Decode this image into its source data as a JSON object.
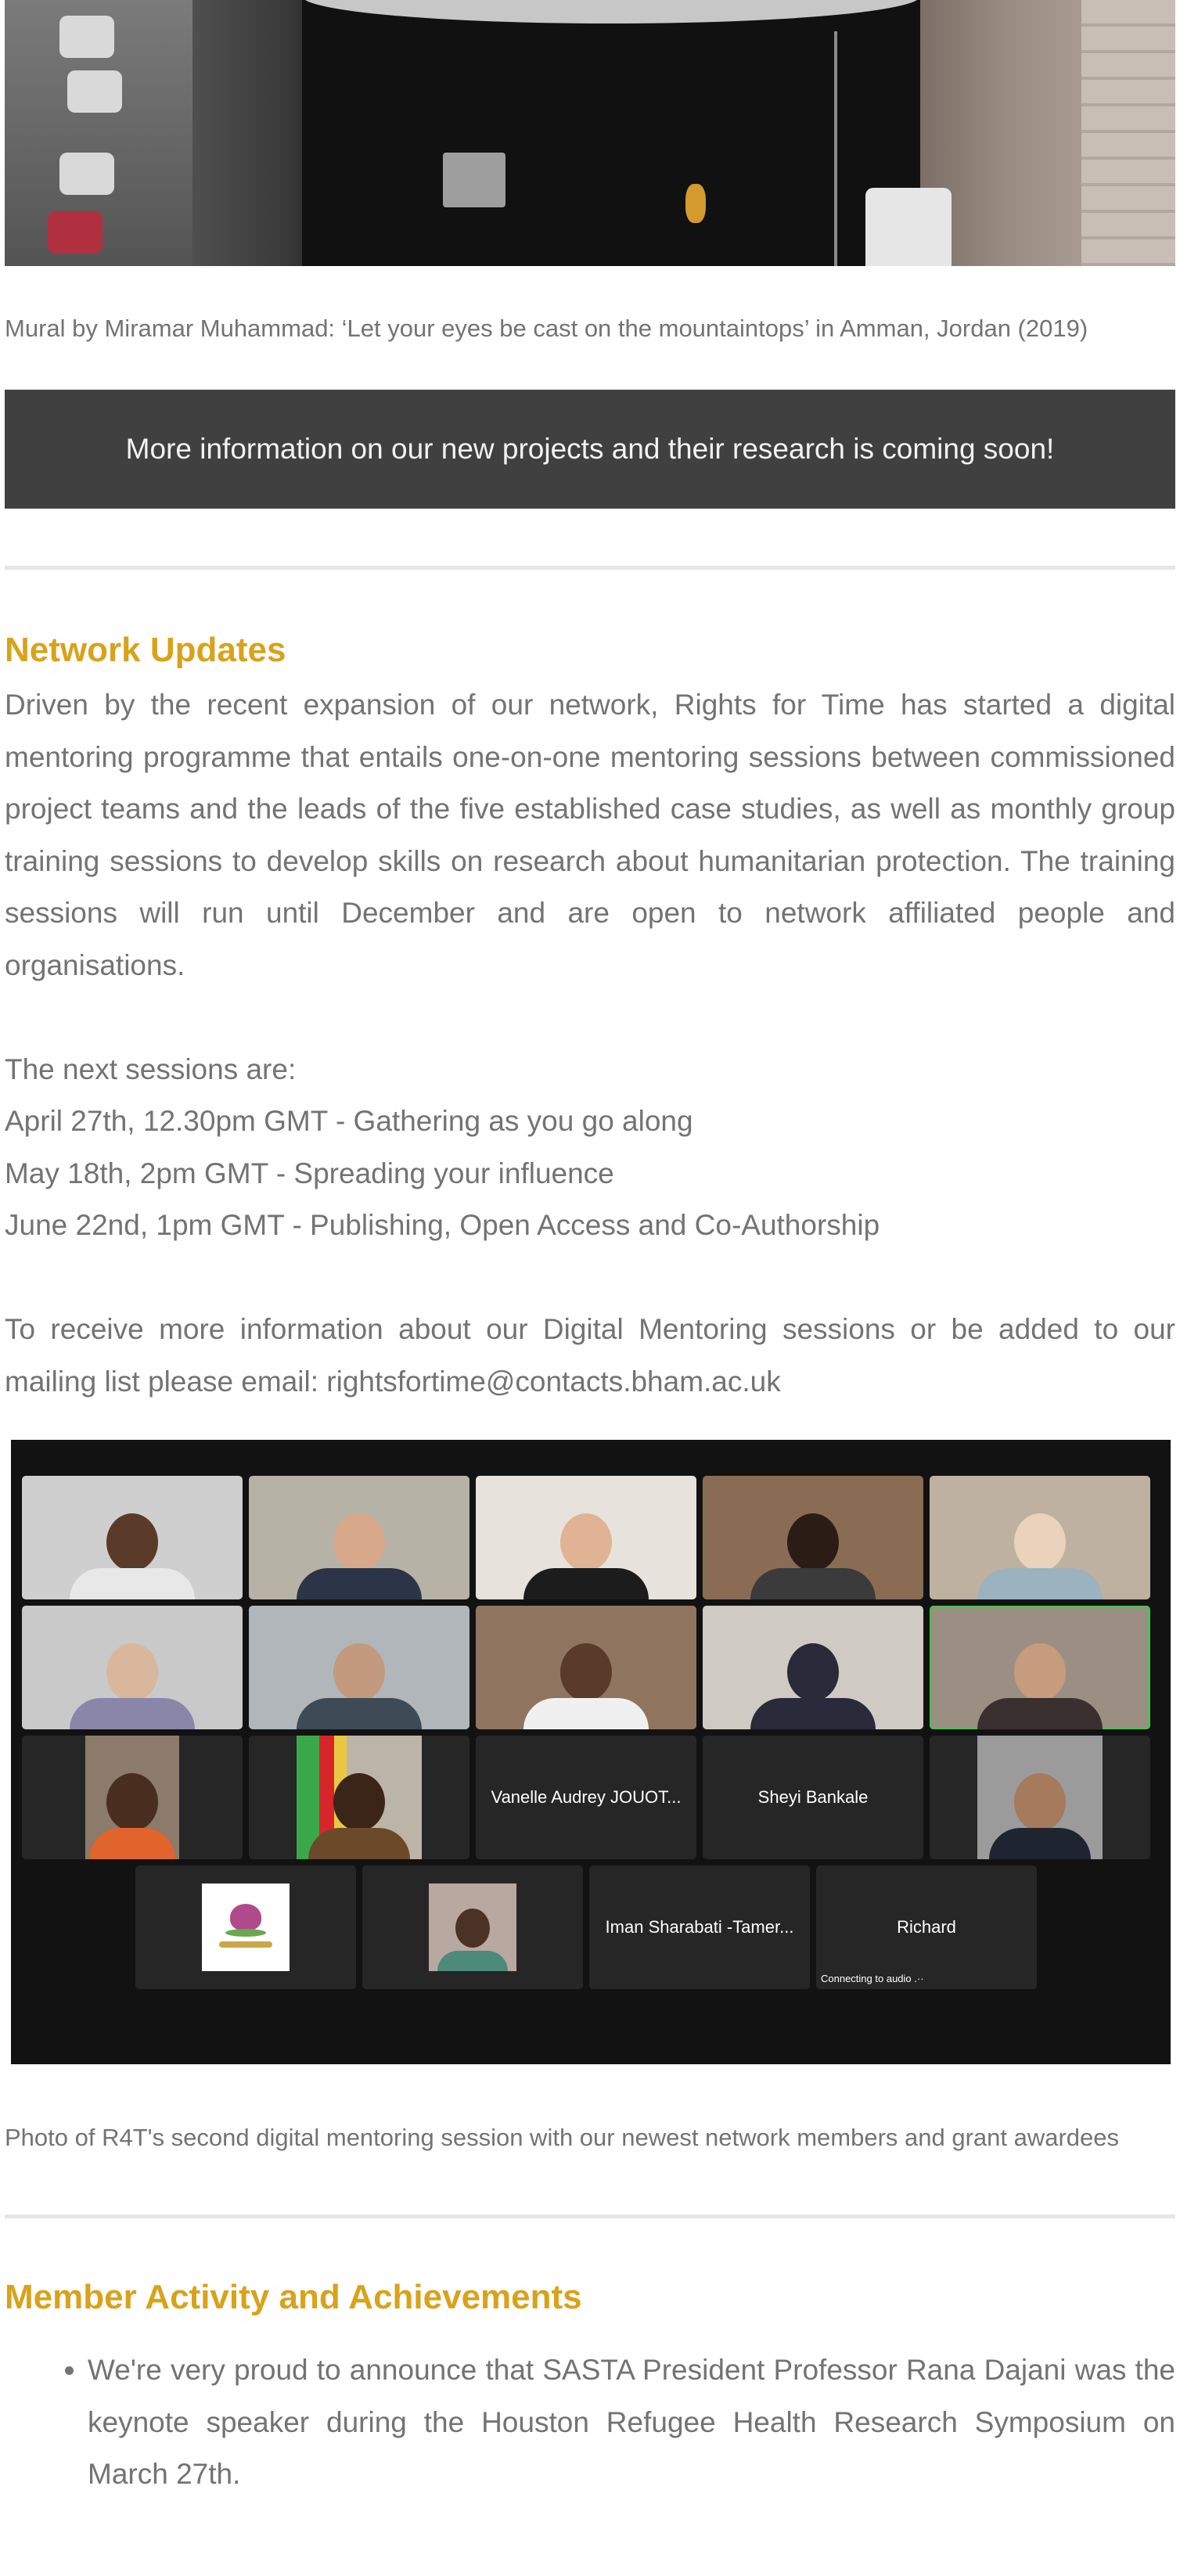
{
  "hero_image": {
    "description_icon": "mural-photo"
  },
  "hero_caption": "Mural by Miramar Muhammad: ‘Let your eyes be cast on the mountaintops’ in Amman, Jordan (2019)",
  "banner_text": "More information on our new projects and their research is coming soon!",
  "network_updates": {
    "heading": "Network Updates",
    "intro": "Driven by the recent expansion of our network, Rights for Time has started a digital mentoring programme that entails one-on-one mentoring sessions between commissioned project teams and the leads of the five established case studies, as well as monthly group training sessions to develop skills on research about humanitarian protection. The training sessions will run until December and are open to network affiliated people and organisations.",
    "sessions_intro": "The next sessions are:",
    "sessions": [
      "April 27th, 12.30pm GMT - Gathering as you go along",
      "May 18th, 2pm GMT - Spreading your influence",
      "June 22nd, 1pm GMT - Publishing, Open Access and Co-Authorship"
    ],
    "contact_text": "To receive more information about our Digital Mentoring sessions or be added to our mailing list please email: rightsfortime@contacts.bham.ac.uk"
  },
  "zoom_call": {
    "named_tiles": [
      "Vanelle Audrey JOUOT...",
      "Sheyi Bankale",
      "Iman Sharabati -Tamer...",
      "Richard"
    ],
    "status_text": "Connecting to audio  .··",
    "active_speaker_color": "#4fbf4f"
  },
  "zoom_caption": "Photo of R4T's second digital mentoring session with our newest network members and grant awardees",
  "member_activity": {
    "heading": "Member Activity and Achievements",
    "items": [
      "We're very proud to announce that SASTA President Professor Rana Dajani was the keynote speaker during the Houston Refugee Health Research Symposium on March 27th."
    ]
  },
  "colors": {
    "accent": "#d9a21b",
    "banner_bg": "#404040",
    "text": "#737373"
  }
}
